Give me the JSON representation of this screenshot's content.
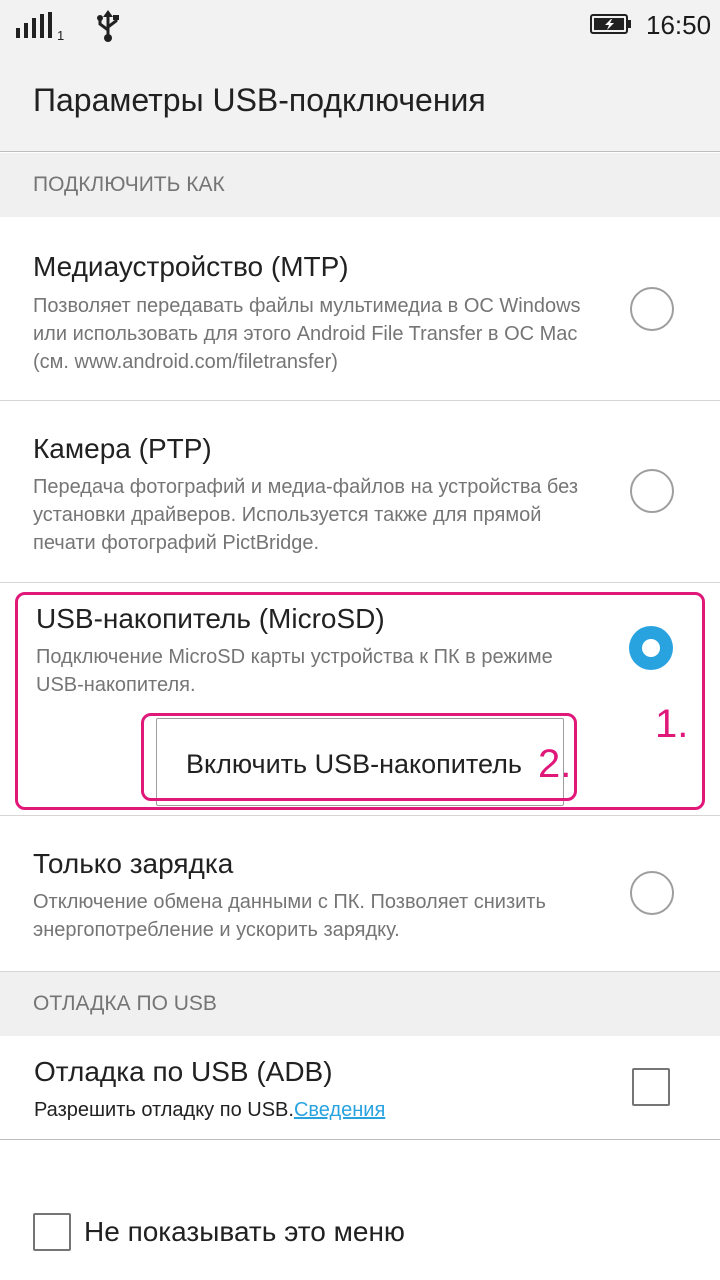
{
  "status_bar": {
    "sim_number": "1",
    "time": "16:50",
    "icons": [
      "signal-icon",
      "usb-icon",
      "battery-charging-icon"
    ]
  },
  "title": "Параметры USB-подключения",
  "sections": {
    "connect_as": "ПОДКЛЮЧИТЬ КАК",
    "usb_debug": "ОТЛАДКА ПО USB"
  },
  "options": [
    {
      "title": "Медиаустройство (MTP)",
      "description": "Позволяет передавать файлы мультимедиа в ОС Windows или использовать для этого Android File Transfer в ОС Mac (см. www.android.com/filetransfer)",
      "selected": false
    },
    {
      "title": "Камера (PTP)",
      "description": "Передача фотографий и медиа-файлов на устройства без установки драйверов. Используется также для прямой печати фотографий PictBridge.",
      "selected": false
    },
    {
      "title": "USB-накопитель (MicroSD)",
      "description": "Подключение MicroSD карты устройства к ПК в режиме USB-накопителя.",
      "selected": true,
      "button_label": "Включить USB-накопитель"
    },
    {
      "title": "Только зарядка",
      "description": "Отключение обмена данными с ПК. Позволяет снизить энергопотребление и ускорить зарядку.",
      "selected": false
    }
  ],
  "debug": {
    "title": "Отладка по USB (ADB)",
    "description": "Разрешить отладку по USB.",
    "link": "Сведения",
    "checked": false
  },
  "dont_show": {
    "label": "Не показывать это меню",
    "checked": false
  },
  "annotations": [
    "1.",
    "2."
  ],
  "colors": {
    "accent": "#29a3e0",
    "annotation": "#e0187a"
  }
}
